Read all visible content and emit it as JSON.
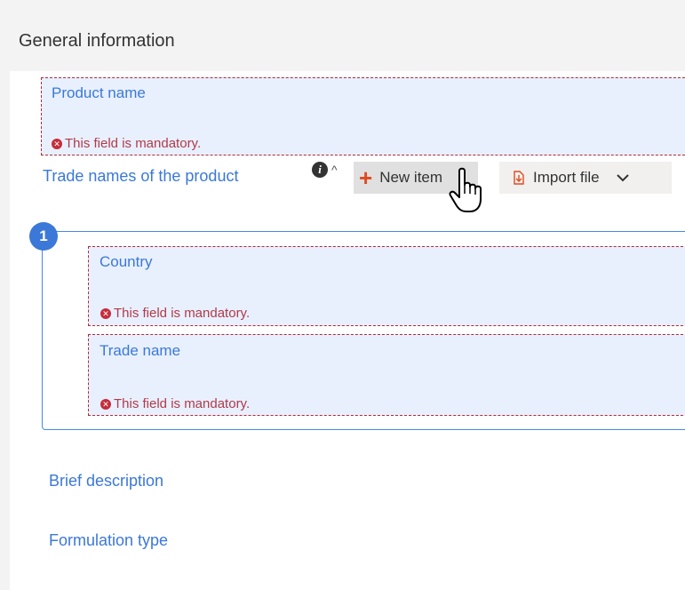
{
  "section": {
    "title": "General information"
  },
  "product_name": {
    "label": "Product name",
    "error": "This field is mandatory."
  },
  "trade_names": {
    "label": "Trade names of the product",
    "info_icon": "i",
    "caret": "^",
    "new_item_label": "New item",
    "import_label": "Import file"
  },
  "trade_item": {
    "number": "1",
    "country": {
      "label": "Country",
      "error": "This field is mandatory."
    },
    "trade_name": {
      "label": "Trade name",
      "error": "This field is mandatory."
    }
  },
  "brief_description": {
    "label": "Brief description"
  },
  "formulation_type": {
    "label": "Formulation type"
  },
  "icons": {
    "error": "error-circle-icon",
    "info": "info-icon",
    "add": "plus-icon",
    "import": "import-file-icon",
    "dropdown": "chevron-down-icon",
    "cursor": "hand-pointer-icon"
  },
  "colors": {
    "accent_blue": "#3b78d8",
    "error_red": "#b23a48",
    "field_bg": "#e8f0fe",
    "plus_orange": "#e04a1f"
  }
}
